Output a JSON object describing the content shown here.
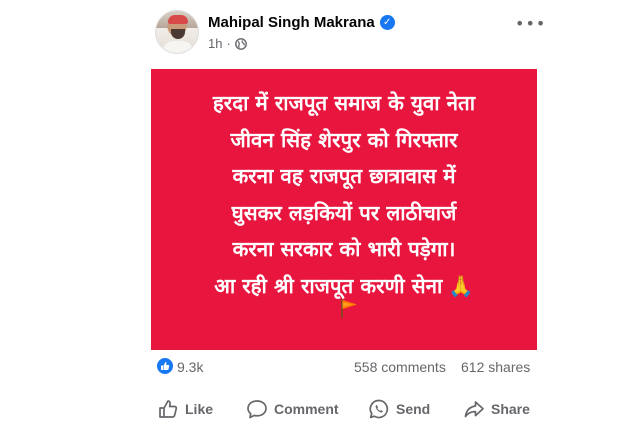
{
  "post": {
    "author": "Mahipal Singh Makrana",
    "time": "1h",
    "separator": "·",
    "more_glyph": "•••",
    "image_text": {
      "lines": [
        "हरदा में राजपूत समाज के युवा नेता",
        "जीवन सिंह शेरपुर को गिरफ्तार",
        "करना वह राजपूत छात्रावास में",
        "घुसकर लड़कियों पर लाठीचार्ज",
        "करना सरकार को भारी पड़ेगा।",
        "आ रही श्री राजपूत करणी सेना"
      ],
      "emoji": "🙏"
    },
    "icons": {
      "verified": "verified-badge-icon",
      "privacy": "globe-icon",
      "flag": "saffron-flag-icon"
    }
  },
  "stats": {
    "reactions": "9.3k",
    "comments": "558 comments",
    "shares": "612 shares"
  },
  "actions": {
    "like": "Like",
    "comment": "Comment",
    "send": "Send",
    "share": "Share"
  },
  "colors": {
    "card_background": "#e8163f",
    "accent_blue": "#1877f2",
    "muted_text": "#65676b"
  }
}
